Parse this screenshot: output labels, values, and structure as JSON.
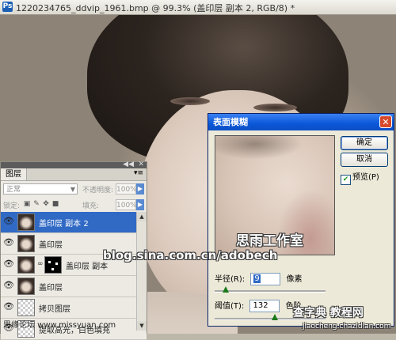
{
  "window": {
    "app_icon": "Ps",
    "title": "1220234765_ddvip_1961.bmp @ 99.3% (盖印层 副本 2, RGB/8) *"
  },
  "watermarks": {
    "studio": "思雨工作室",
    "blog": "blog.sina.com.cn/adobech",
    "forum": "思缘论坛 www.missyuan.com",
    "site": "查字典 教程网",
    "site_url": "jiaocheng.chazidian.com"
  },
  "layers_panel": {
    "tab_label": "图层",
    "blend_mode": "正常",
    "opacity_label": "不透明度:",
    "opacity_value": "100%",
    "lock_label": "锁定:",
    "fill_label": "填充:",
    "fill_value": "100%",
    "layers": [
      {
        "name": "盖印层 副本 2",
        "selected": true
      },
      {
        "name": "盖印层",
        "selected": false
      },
      {
        "name": "盖印层 副本",
        "selected": false
      },
      {
        "name": "盖印层",
        "selected": false
      },
      {
        "name": "拷贝图层",
        "selected": false
      },
      {
        "name": "提取高光，白色填充",
        "selected": false
      }
    ]
  },
  "dialog": {
    "title": "表面模糊",
    "ok_label": "确定",
    "cancel_label": "取消",
    "preview_label": "预览(P)",
    "preview_checked": true,
    "radius_label": "半径(R):",
    "radius_value": "9",
    "radius_unit": "像素",
    "threshold_label": "阈值(T):",
    "threshold_value": "132",
    "threshold_unit": "色阶"
  }
}
